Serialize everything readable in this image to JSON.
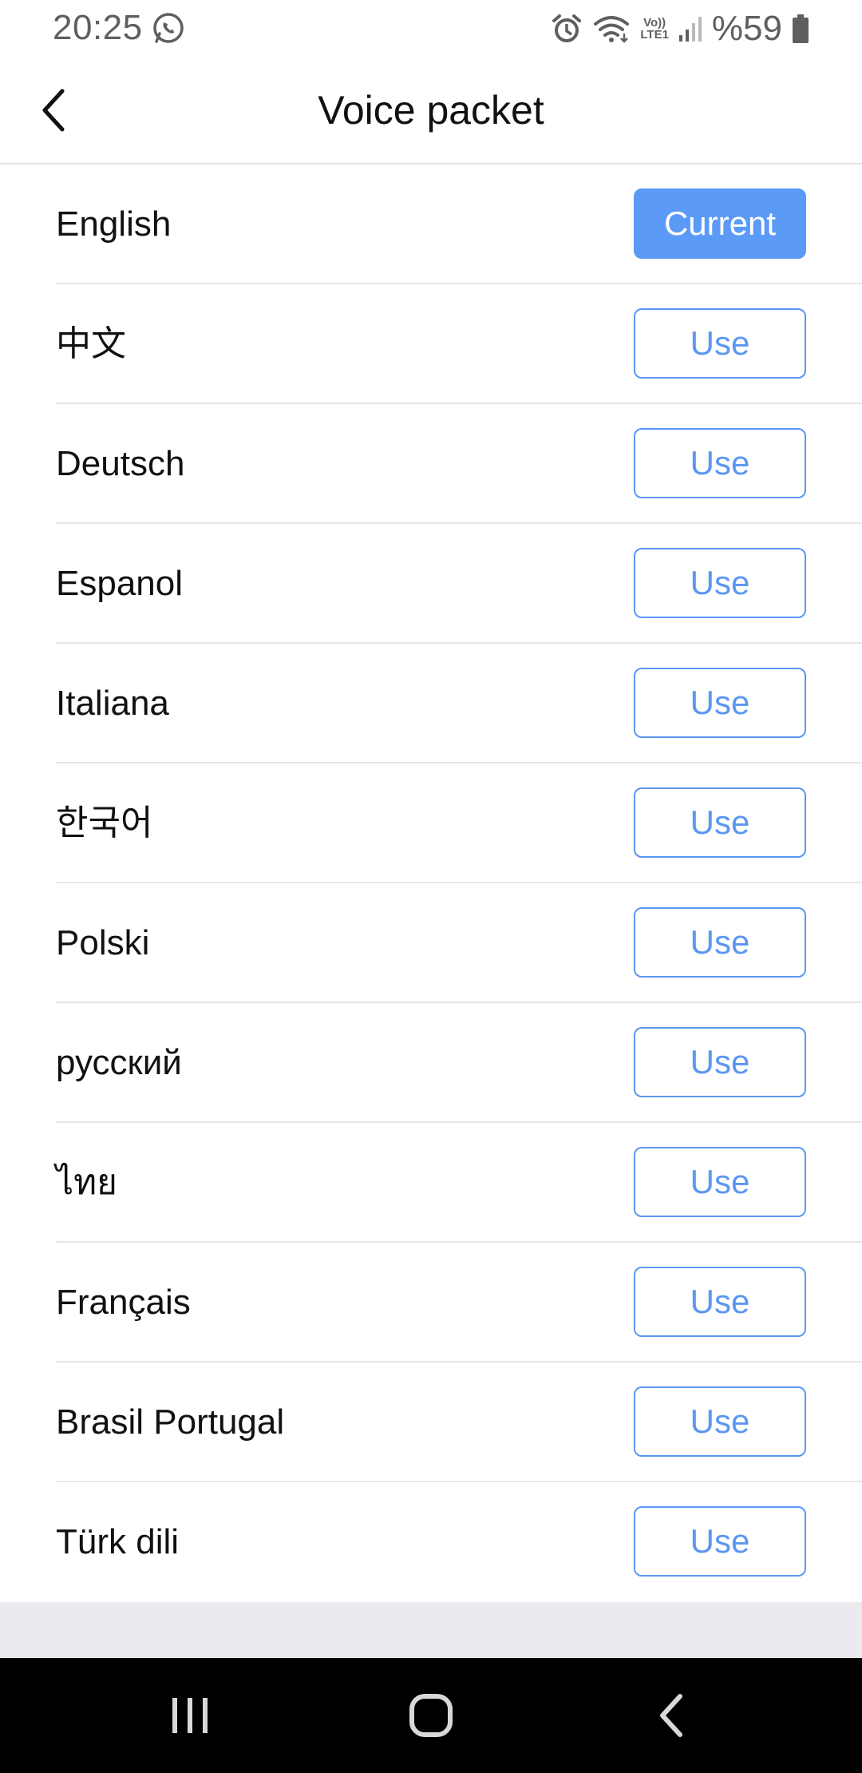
{
  "status_bar": {
    "time": "20:25",
    "volte_top": "Vo))",
    "volte_bottom": "LTE1",
    "battery": "%59"
  },
  "header": {
    "title": "Voice packet"
  },
  "languages": [
    {
      "name": "English",
      "action": "Current",
      "is_current": true
    },
    {
      "name": "中文",
      "action": "Use",
      "is_current": false
    },
    {
      "name": "Deutsch",
      "action": "Use",
      "is_current": false
    },
    {
      "name": "Espanol",
      "action": "Use",
      "is_current": false
    },
    {
      "name": "Italiana",
      "action": "Use",
      "is_current": false
    },
    {
      "name": "한국어",
      "action": "Use",
      "is_current": false
    },
    {
      "name": "Polski",
      "action": "Use",
      "is_current": false
    },
    {
      "name": "русский",
      "action": "Use",
      "is_current": false
    },
    {
      "name": "ไทย",
      "action": "Use",
      "is_current": false
    },
    {
      "name": "Français",
      "action": "Use",
      "is_current": false
    },
    {
      "name": "Brasil Portugal",
      "action": "Use",
      "is_current": false
    },
    {
      "name": "Türk dili",
      "action": "Use",
      "is_current": false
    }
  ],
  "colors": {
    "accent": "#5b9af7",
    "text": "#111111",
    "divider": "#e6e6e8",
    "footer_bg": "#ebebef",
    "nav_bg": "#000000"
  },
  "icons": {
    "status": [
      "whatsapp-icon",
      "alarm-icon",
      "wifi-icon",
      "signal-icon",
      "battery-icon"
    ],
    "header": [
      "chevron-left-icon"
    ],
    "nav": [
      "recent-apps-icon",
      "home-icon",
      "back-icon"
    ]
  }
}
